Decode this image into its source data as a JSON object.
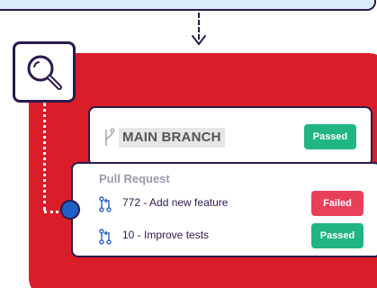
{
  "colors": {
    "accent_red": "#d91e2a",
    "outline": "#2b1a4a",
    "passed": "#20b583",
    "failed": "#ea3f5a",
    "node_blue": "#1f5fc6",
    "top_box": "#d9ecfa"
  },
  "icons": {
    "search": "magnifier-icon",
    "branch": "git-branch-icon",
    "pull_request": "git-pull-request-icon"
  },
  "main_branch": {
    "label": "MAIN BRANCH",
    "status": "Passed"
  },
  "pull_request": {
    "title": "Pull Request",
    "items": [
      {
        "label": "772 - Add new feature",
        "status": "Failed"
      },
      {
        "label": "10 - Improve tests",
        "status": "Passed"
      }
    ]
  }
}
